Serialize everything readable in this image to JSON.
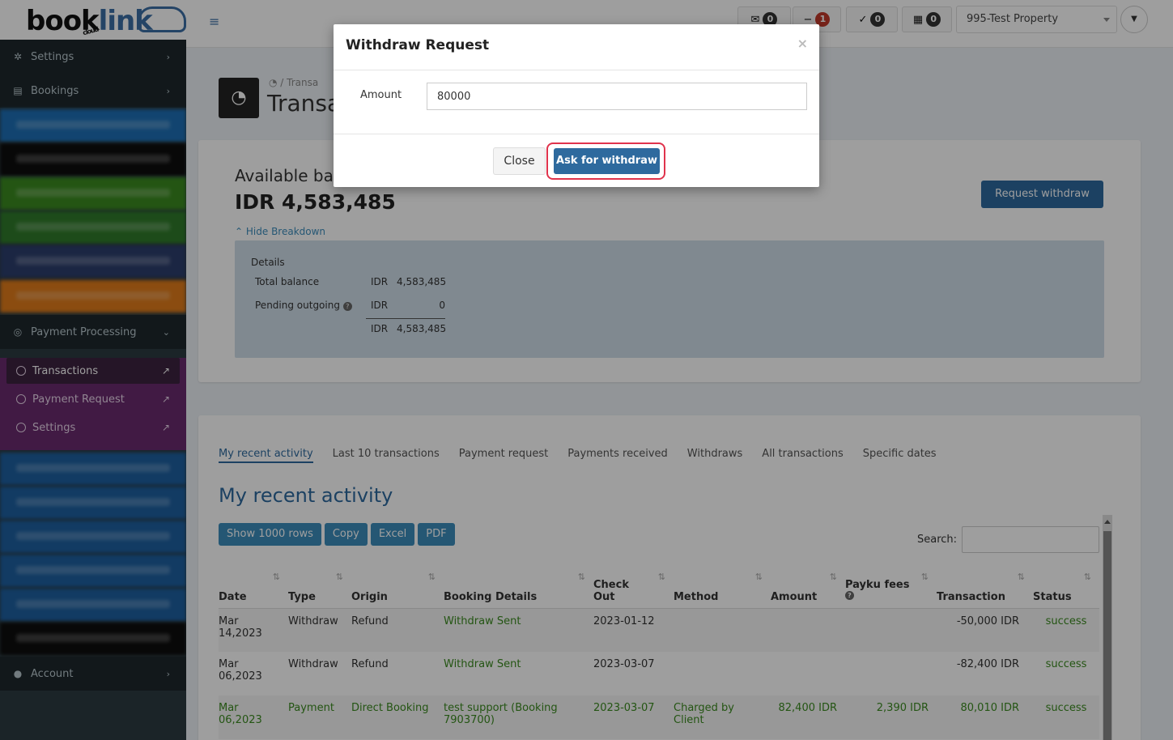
{
  "topbar": {
    "logo_main": "book",
    "logo_accent": "link",
    "logo_sub": "cloud",
    "badges": [
      {
        "icon": "envelope-icon",
        "glyph": "✉",
        "count": "0"
      },
      {
        "icon": "minus-icon",
        "glyph": "−",
        "count": "1"
      },
      {
        "icon": "check-icon",
        "glyph": "✓",
        "count": "0"
      },
      {
        "icon": "calendar-icon",
        "glyph": "▦",
        "count": "0"
      }
    ],
    "property": "995-Test Property"
  },
  "sidebar": {
    "settings": "Settings",
    "bookings": "Bookings",
    "payment_processing": "Payment Processing",
    "sub": {
      "transactions": "Transactions",
      "payment_request": "Payment Request",
      "settings": "Settings"
    },
    "account": "Account"
  },
  "header": {
    "breadcrumb": "Transa",
    "title": "Transa"
  },
  "balance": {
    "label": "Available ba",
    "value": "IDR 4,583,485",
    "hide_breakdown": "Hide Breakdown",
    "request_withdraw": "Request withdraw",
    "details_title": "Details",
    "rows": [
      {
        "label": "Total balance",
        "currency": "IDR",
        "amount": "4,583,485"
      },
      {
        "label": "Pending outgoing",
        "currency": "IDR",
        "amount": "0"
      },
      {
        "label": "",
        "currency": "IDR",
        "amount": "4,583,485"
      }
    ]
  },
  "activity": {
    "tabs": [
      "My recent activity",
      "Last 10 transactions",
      "Payment request",
      "Payments received",
      "Withdraws",
      "All transactions",
      "Specific dates"
    ],
    "title": "My recent activity",
    "buttons": [
      "Show 1000 rows",
      "Copy",
      "Excel",
      "PDF"
    ],
    "search_label": "Search:",
    "columns": [
      "Date",
      "Type",
      "Origin",
      "Booking Details",
      "Check Out",
      "Method",
      "Amount",
      "Payku fees",
      "Transaction",
      "Status"
    ],
    "rows": [
      {
        "date": "Mar 14,2023",
        "type": "Withdraw",
        "origin": "Refund",
        "booking": "Withdraw Sent",
        "checkout": "2023-01-12",
        "method": "",
        "amount": "",
        "fees": "",
        "transaction": "-50,000 IDR",
        "status": "success"
      },
      {
        "date": "Mar 06,2023",
        "type": "Withdraw",
        "origin": "Refund",
        "booking": "Withdraw Sent",
        "checkout": "2023-03-07",
        "method": "",
        "amount": "",
        "fees": "",
        "transaction": "-82,400 IDR",
        "status": "success"
      },
      {
        "date": "Mar 06,2023",
        "type": "Payment",
        "origin": "Direct Booking",
        "booking": "test support (Booking 7903700)",
        "checkout": "2023-03-07",
        "method": "Charged by Client",
        "amount": "82,400 IDR",
        "fees": "2,390 IDR",
        "transaction": "80,010 IDR",
        "status": "success"
      }
    ]
  },
  "modal": {
    "title": "Withdraw Request",
    "close_x": "×",
    "amount_label": "Amount",
    "amount_value": "80000",
    "close_button": "Close",
    "ask_button": "Ask for withdraw"
  }
}
